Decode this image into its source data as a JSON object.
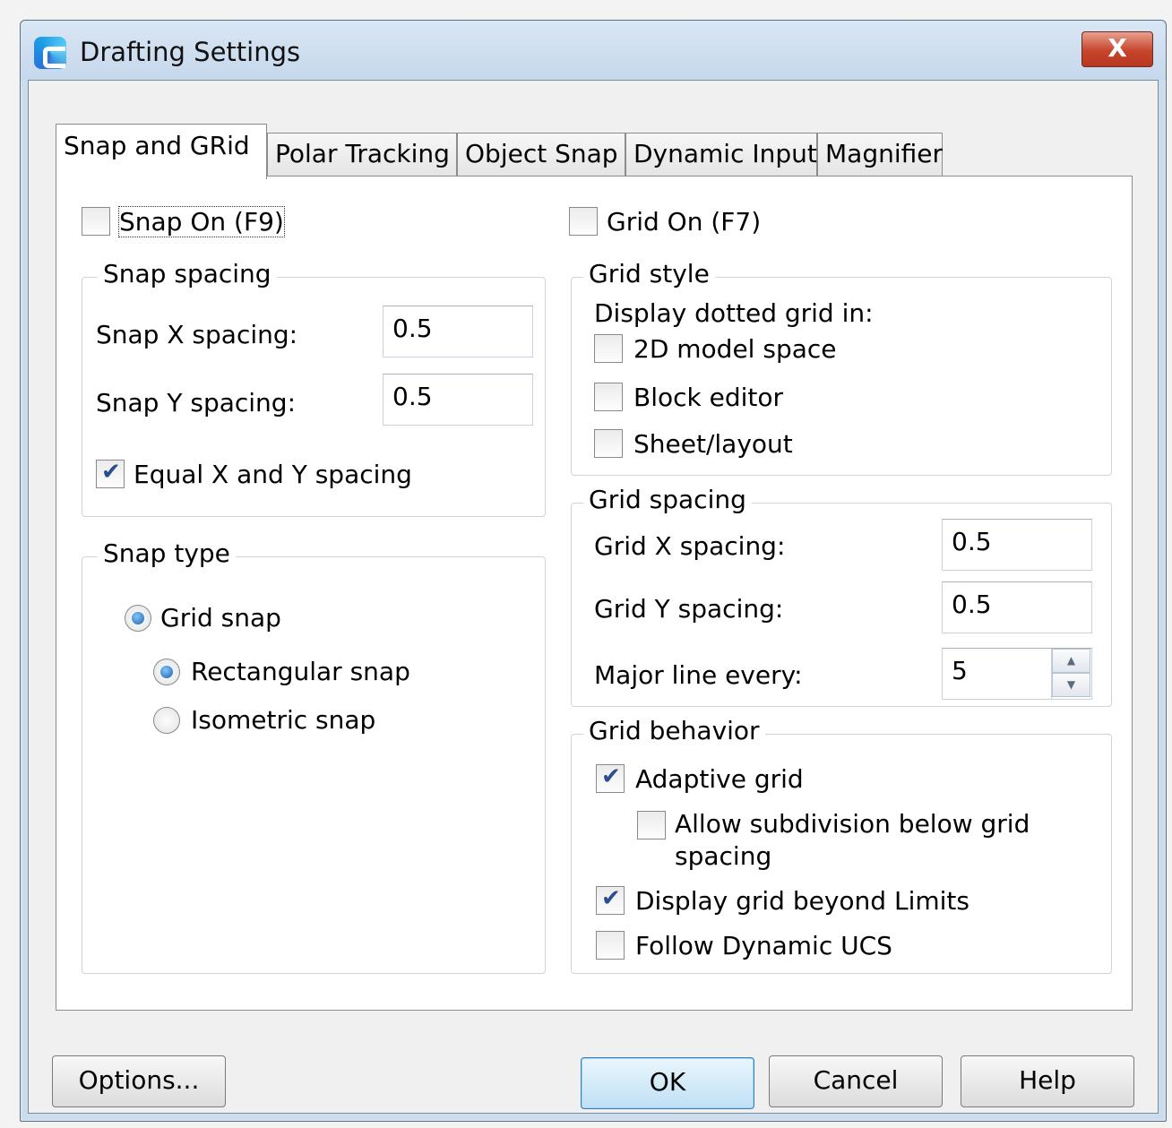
{
  "window": {
    "title": "Drafting Settings",
    "close_glyph": "X"
  },
  "tabs": [
    "Snap and GRid",
    "Polar Tracking",
    "Object Snap",
    "Dynamic Input",
    "Magnifier"
  ],
  "snap": {
    "snap_on": {
      "label": "Snap On (F9)",
      "checked": false
    },
    "spacing_group": "Snap spacing",
    "x_label": "Snap X spacing:",
    "x_value": "0.5",
    "y_label": "Snap Y spacing:",
    "y_value": "0.5",
    "equal": {
      "label": "Equal X and Y spacing",
      "checked": true
    },
    "type_group": "Snap type",
    "grid_snap": "Grid snap",
    "rect_snap": "Rectangular snap",
    "iso_snap": "Isometric snap"
  },
  "grid": {
    "grid_on": {
      "label": "Grid On (F7)",
      "checked": false
    },
    "style_group": "Grid style",
    "display_label": "Display dotted grid in:",
    "model_space": "2D model space",
    "block_editor": "Block editor",
    "sheet_layout": "Sheet/layout",
    "spacing_group": "Grid spacing",
    "x_label": "Grid X spacing:",
    "x_value": "0.5",
    "y_label": "Grid Y spacing:",
    "y_value": "0.5",
    "major_label": "Major line every:",
    "major_value": "5",
    "behavior_group": "Grid behavior",
    "adaptive": "Adaptive grid",
    "subdivision_line1": "Allow subdivision below grid",
    "subdivision_line2": "spacing",
    "beyond_limits": "Display grid beyond Limits",
    "follow_ucs": "Follow Dynamic UCS"
  },
  "buttons": {
    "options": "Options...",
    "ok": "OK",
    "cancel": "Cancel",
    "help": "Help"
  }
}
